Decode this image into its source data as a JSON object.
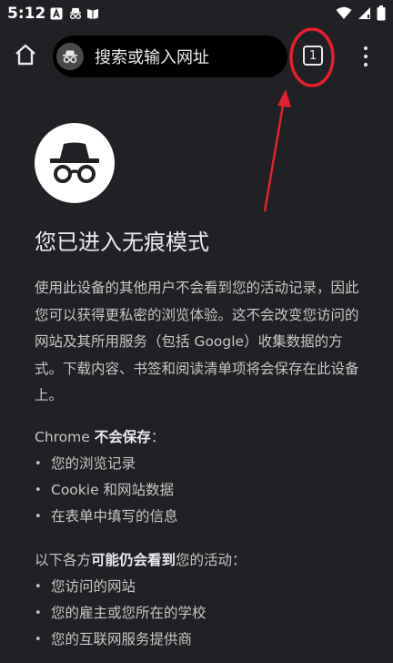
{
  "status": {
    "time": "5:12"
  },
  "toolbar": {
    "omnibox_placeholder": "搜索或输入网址",
    "tab_count": "1"
  },
  "content": {
    "title": "您已进入无痕模式",
    "paragraph": "使用此设备的其他用户不会看到您的活动记录，因此您可以获得更私密的浏览体验。这不会改变您访问的网站及其所用服务（包括 Google）收集数据的方式。下载内容、书签和阅读清单项将会保存在此设备上。",
    "not_saved": {
      "heading_prefix": "Chrome ",
      "heading_bold": "不会保存",
      "heading_suffix": "：",
      "items": [
        "您的浏览记录",
        "Cookie 和网站数据",
        "在表单中填写的信息"
      ]
    },
    "may_see": {
      "heading_prefix": "以下各方",
      "heading_bold": "可能仍会看到",
      "heading_suffix": "您的活动：",
      "items": [
        "您访问的网站",
        "您的雇主或您所在的学校",
        "您的互联网服务提供商"
      ]
    }
  },
  "colors": {
    "background": "#202124",
    "annotation": "#e4202e",
    "omnibox": "#000000"
  },
  "icons": [
    "a-square-icon",
    "incognito-icon",
    "book-icon",
    "wifi-icon",
    "signal-icon",
    "battery-icon",
    "home-icon",
    "tab-switcher-icon",
    "more-vert-icon"
  ]
}
